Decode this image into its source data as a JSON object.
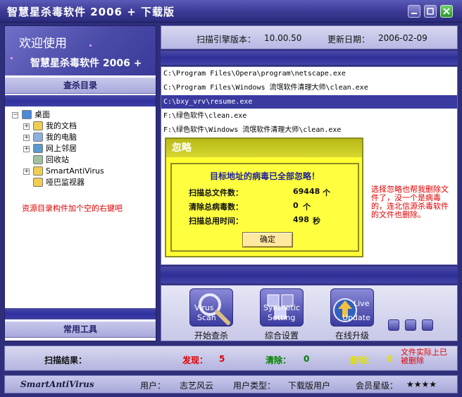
{
  "window": {
    "title": "智慧星杀毒软件 2006 + 下载版",
    "buttons": [
      "minimize",
      "maximize",
      "close"
    ]
  },
  "sidebar": {
    "welcome_line1": "欢迎使用",
    "welcome_line2": "智慧星杀毒软件 2006 +",
    "directory_header": "查杀目录",
    "tree": [
      {
        "label": "桌面",
        "icon": "desktop-icon",
        "expander": "−",
        "indent": 0
      },
      {
        "label": "我的文档",
        "icon": "folder-icon",
        "expander": "+",
        "indent": 1
      },
      {
        "label": "我的电脑",
        "icon": "computer-icon",
        "expander": "+",
        "indent": 1
      },
      {
        "label": "网上邻居",
        "icon": "network-icon",
        "expander": "+",
        "indent": 1
      },
      {
        "label": "回收站",
        "icon": "recycle-bin-icon",
        "expander": "",
        "indent": 1
      },
      {
        "label": "SmartAntiVirus",
        "icon": "folder-icon",
        "expander": "+",
        "indent": 1
      },
      {
        "label": "哑巴监视器",
        "icon": "folder-icon",
        "expander": "",
        "indent": 1
      }
    ],
    "annotation": "资源目录构件加个空的右键吧",
    "tools_header": "常用工具"
  },
  "engine": {
    "version_label": "扫描引擎版本：",
    "version_value": "10.00.50",
    "date_label": "更新日期：",
    "date_value": "2006-02-09"
  },
  "log": [
    "C:\\Program Files\\Opera\\program\\netscape.exe",
    "C:\\Program Files\\Windows 流氓软件清理大师\\clean.exe",
    "C:\\bxy_vrv\\resume.exe",
    "F:\\绿色软件\\clean.exe",
    "F:\\绿色软件\\Windows 流氓软件清理大师\\clean.exe"
  ],
  "dialog": {
    "title": "忽略",
    "message": "目标地址的病毒已全部忽略！",
    "files_label": "扫描总文件数：",
    "files_value": "69448",
    "files_unit": "个",
    "cleared_label": "清除总病毒数：",
    "cleared_value": "0",
    "cleared_unit": "个",
    "time_label": "扫描总用时间：",
    "time_value": "498",
    "time_unit": "秒",
    "ok": "确定"
  },
  "annotation_right": "选择忽略也帮我删除文件了，没一个是病毒的，连北信源杀毒软件的文件也删除。",
  "tools": [
    {
      "en1": "Virus",
      "en2": "Scan",
      "label": "开始查杀",
      "icon": "magnifier-icon"
    },
    {
      "en1": "Synthetic",
      "en2": "Setting",
      "label": "综合设置",
      "icon": "settings-icon"
    },
    {
      "en1": "Live",
      "en2": "Update",
      "label": "在线升级",
      "icon": "update-arrow-icon"
    }
  ],
  "status": {
    "result_label": "扫描结果：",
    "found_label": "发现：",
    "found_value": "5",
    "cleared_label": "清除：",
    "cleared_value": "0",
    "deleted_label": "删除：",
    "deleted_value": "0",
    "annotation": "文件实际上已被删除"
  },
  "footer": {
    "brand": "SmartAntiVirus",
    "user_label": "用户：",
    "user_value": "志艺风云",
    "type_label": "用户类型：",
    "type_value": "下载版用户",
    "level_label": "会员星级：",
    "level_value": "★★★★"
  },
  "colors": {
    "accent": "#3a3aa0",
    "found": "#e00000",
    "cleared": "#008000",
    "deleted": "#e0e000",
    "dialog_bg": "#ffff33",
    "annotation": "#e00000"
  }
}
